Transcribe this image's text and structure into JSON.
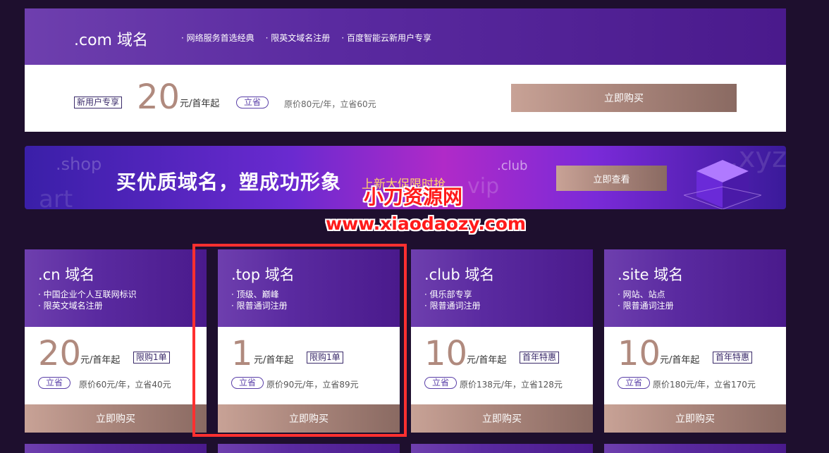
{
  "top_card": {
    "title": ".com 域名",
    "tags": [
      "网络服务首选经典",
      "限英文域名注册",
      "百度智能云新用户专享"
    ],
    "badge": "新用户专享",
    "price": "20",
    "unit": "元/首年起",
    "save_label": "立省",
    "original": "原价80元/年，立省60元",
    "buy_label": "立即购买"
  },
  "banner": {
    "ghost_words": [
      ".shop",
      "art",
      "vip",
      ".club",
      ".xyz"
    ],
    "headline": "买优质域名，塑成功形象",
    "subline": "上新大促限时抢",
    "view_label": "立即查看"
  },
  "watermark": {
    "cn": "小刀资源网",
    "url": "www.xiaodaozy.com"
  },
  "cards": [
    {
      "title": ".cn 域名",
      "features": [
        "中国企业个人互联网标识",
        "限英文域名注册"
      ],
      "price": "20",
      "unit": "元/首年起",
      "badge": "限购1单",
      "save_label": "立省",
      "original": "原价60元/年，立省40元",
      "buy_label": "立即购买"
    },
    {
      "title": ".top 域名",
      "features": [
        "顶级、巅峰",
        "限普通词注册"
      ],
      "price": "1",
      "unit": "元/首年起",
      "badge": "限购1单",
      "save_label": "立省",
      "original": "原价90元/年，立省89元",
      "buy_label": "立即购买"
    },
    {
      "title": ".club 域名",
      "features": [
        "俱乐部专享",
        "限普通词注册"
      ],
      "price": "10",
      "unit": "元/首年起",
      "badge": "首年特惠",
      "save_label": "立省",
      "original": "原价138元/年，立省128元",
      "buy_label": "立即购买"
    },
    {
      "title": ".site 域名",
      "features": [
        "网站、站点",
        "限普通词注册"
      ],
      "price": "10",
      "unit": "元/首年起",
      "badge": "首年特惠",
      "save_label": "立省",
      "original": "原价180元/年，立省170元",
      "buy_label": "立即购买"
    }
  ],
  "colors": {
    "page_bg": "#1e0f2e",
    "header_purple": "#5a2aa0",
    "price_color": "#b08a7e",
    "buy_gradient_start": "#c8a296",
    "highlight_red": "#ff3030"
  }
}
